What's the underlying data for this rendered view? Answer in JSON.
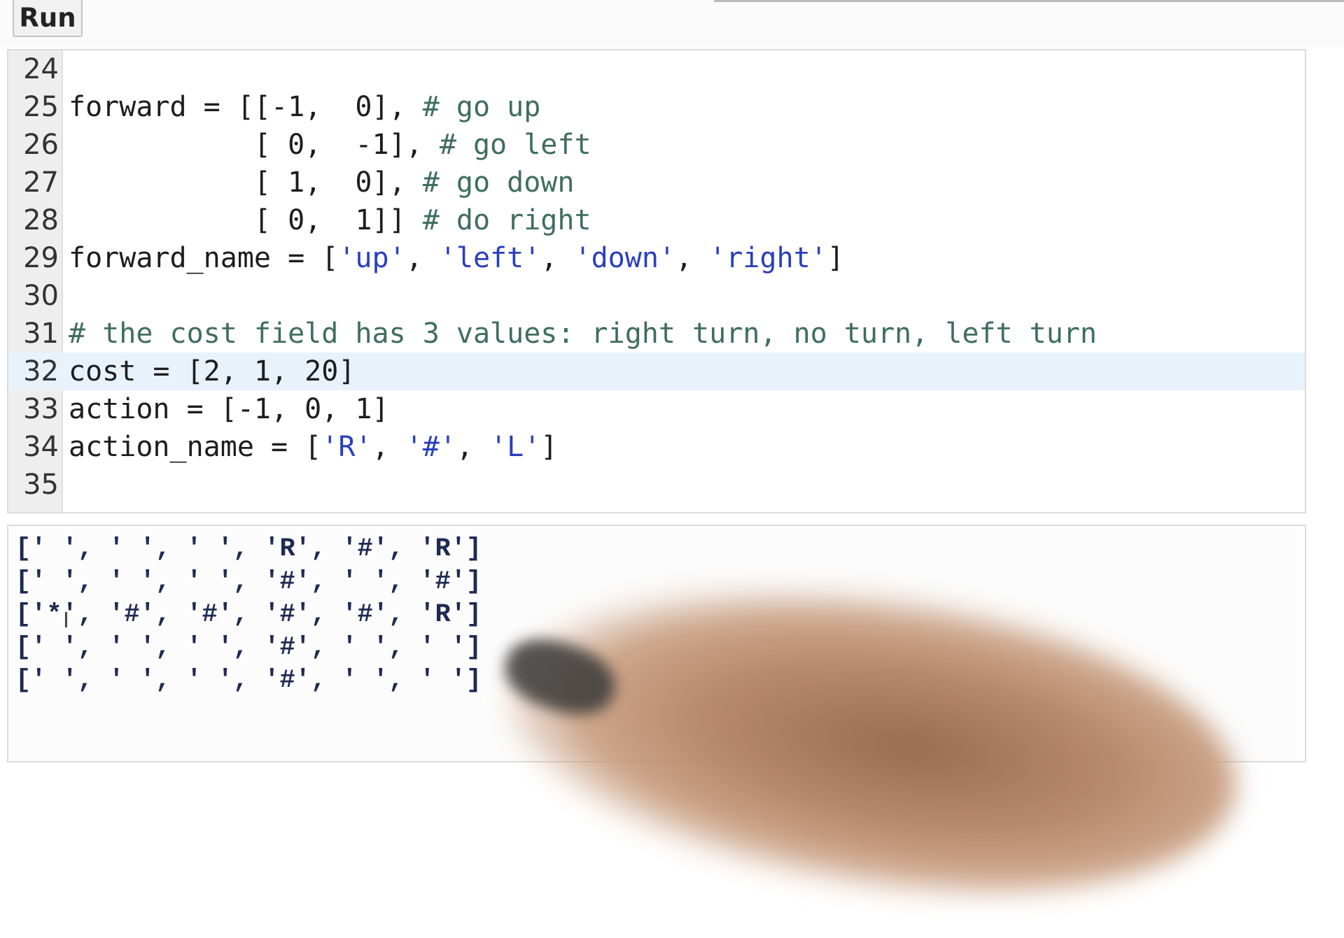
{
  "toolbar": {
    "run_label": "Run"
  },
  "editor": {
    "active_line": 32,
    "lines": [
      {
        "number": "24",
        "segments": []
      },
      {
        "number": "25",
        "segments": [
          {
            "t": "plain",
            "v": "forward = [[-1,  0], "
          },
          {
            "t": "com",
            "v": "# go up"
          }
        ]
      },
      {
        "number": "26",
        "segments": [
          {
            "t": "plain",
            "v": "           [ 0,  -1], "
          },
          {
            "t": "com",
            "v": "# go left"
          }
        ]
      },
      {
        "number": "27",
        "segments": [
          {
            "t": "plain",
            "v": "           [ 1,  0], "
          },
          {
            "t": "com",
            "v": "# go down"
          }
        ]
      },
      {
        "number": "28",
        "segments": [
          {
            "t": "plain",
            "v": "           [ 0,  1]] "
          },
          {
            "t": "com",
            "v": "# do right"
          }
        ]
      },
      {
        "number": "29",
        "segments": [
          {
            "t": "plain",
            "v": "forward_name = ["
          },
          {
            "t": "str",
            "v": "'up'"
          },
          {
            "t": "plain",
            "v": ", "
          },
          {
            "t": "str",
            "v": "'left'"
          },
          {
            "t": "plain",
            "v": ", "
          },
          {
            "t": "str",
            "v": "'down'"
          },
          {
            "t": "plain",
            "v": ", "
          },
          {
            "t": "str",
            "v": "'right'"
          },
          {
            "t": "plain",
            "v": "]"
          }
        ]
      },
      {
        "number": "30",
        "segments": []
      },
      {
        "number": "31",
        "segments": [
          {
            "t": "com",
            "v": "# the cost field has 3 values: right turn, no turn, left turn"
          }
        ]
      },
      {
        "number": "32",
        "segments": [
          {
            "t": "plain",
            "v": "cost = [2, 1, 20]"
          }
        ]
      },
      {
        "number": "33",
        "segments": [
          {
            "t": "plain",
            "v": "action = [-1, 0, 1]"
          }
        ]
      },
      {
        "number": "34",
        "segments": [
          {
            "t": "plain",
            "v": "action_name = ["
          },
          {
            "t": "str",
            "v": "'R'"
          },
          {
            "t": "plain",
            "v": ", "
          },
          {
            "t": "str",
            "v": "'#'"
          },
          {
            "t": "plain",
            "v": ", "
          },
          {
            "t": "str",
            "v": "'L'"
          },
          {
            "t": "plain",
            "v": "]"
          }
        ]
      },
      {
        "number": "35",
        "segments": []
      }
    ]
  },
  "output": {
    "lines": [
      "[' ', ' ', ' ', 'R', '#', 'R']",
      "[' ', ' ', ' ', '#', ' ', '#']",
      "['*', '#', '#', '#', '#', 'R']",
      "[' ', ' ', ' ', '#', ' ', ' ']",
      "[' ', ' ', ' ', '#', ' ', ' ']"
    ]
  },
  "colors": {
    "string": "#2a3fbd",
    "comment": "#3f6e5c",
    "active_line": "#e8f2fb",
    "gutter": "#eeeeee"
  }
}
